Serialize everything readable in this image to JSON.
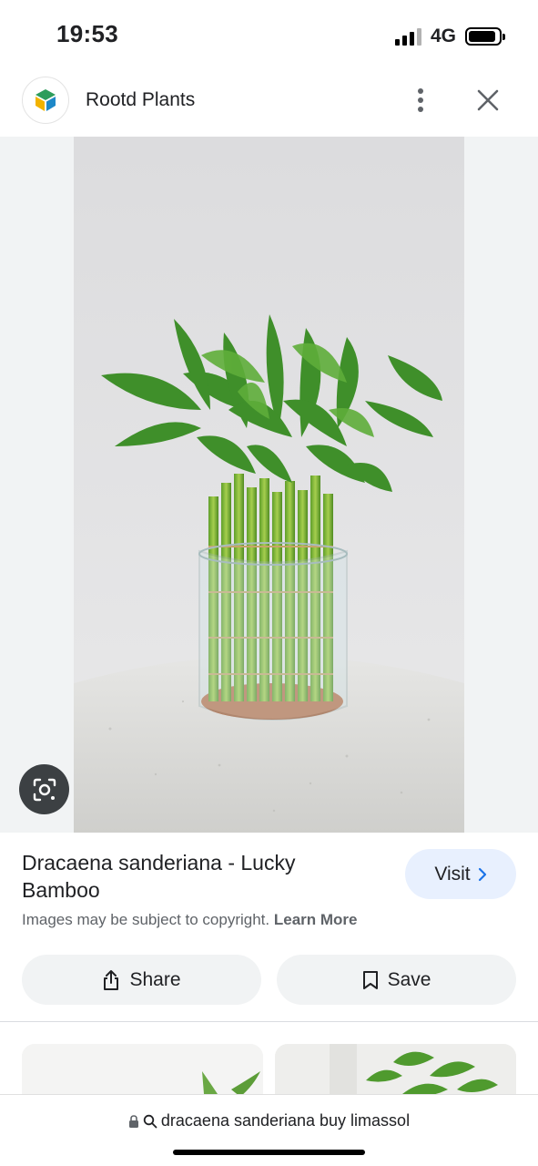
{
  "status_bar": {
    "time": "19:53",
    "network": "4G",
    "battery_level": 0.9,
    "icons": [
      "signal-icon",
      "battery-icon"
    ]
  },
  "header": {
    "site_name": "Rootd Plants",
    "icons": [
      "site-logo-icon",
      "more-vert-icon",
      "close-icon"
    ]
  },
  "image": {
    "icons": [
      "google-lens-icon"
    ]
  },
  "result": {
    "title": "Dracaena sanderiana - Lucky Bamboo",
    "visit_label": "Visit",
    "copyright_text": "Images may be subject to copyright.",
    "learn_more": "Learn More",
    "share_label": "Share",
    "save_label": "Save",
    "icons": [
      "chevron-right-icon",
      "share-icon",
      "bookmark-icon"
    ]
  },
  "url_bar": {
    "query": "dracaena sanderiana buy limassol",
    "icons": [
      "lock-icon",
      "search-icon"
    ]
  },
  "colors": {
    "visit_bg": "#e8f0fe",
    "button_bg": "#f1f3f4",
    "text": "#202124",
    "secondary_text": "#5f6368",
    "accent_blue": "#1a73e8"
  }
}
